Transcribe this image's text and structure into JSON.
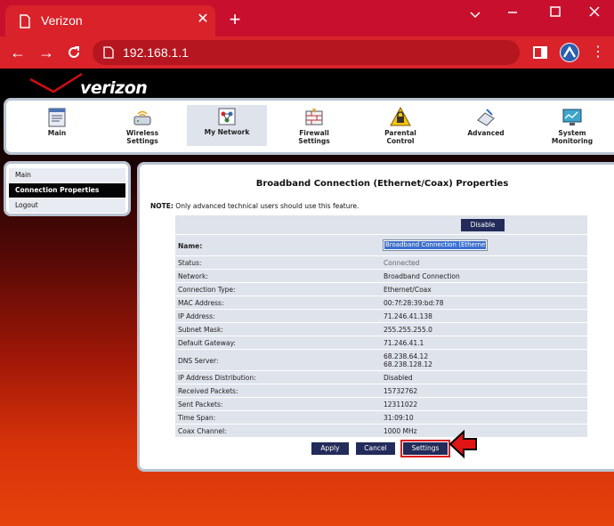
{
  "browser": {
    "tab_title": "Verizon",
    "address": "192.168.1.1",
    "icons": [
      "new-tab-icon",
      "minimize-icon",
      "maximize-icon",
      "close-window-icon",
      "back-icon",
      "forward-icon",
      "reload-icon",
      "info-icon",
      "sidebar-icon",
      "profile-icon",
      "more-icon"
    ]
  },
  "brand": {
    "logo_text": "verizon",
    "accent": "#c8102e"
  },
  "nav": {
    "items": [
      {
        "line1": "Main",
        "line2": ""
      },
      {
        "line1": "Wireless",
        "line2": "Settings"
      },
      {
        "line1": "My Network",
        "line2": ""
      },
      {
        "line1": "Firewall",
        "line2": "Settings"
      },
      {
        "line1": "Parental",
        "line2": "Control"
      },
      {
        "line1": "Advanced",
        "line2": ""
      },
      {
        "line1": "System",
        "line2": "Monitoring"
      }
    ],
    "active": "My Network"
  },
  "sidebar": {
    "items": [
      {
        "label": "Main"
      },
      {
        "label": "Connection Properties"
      },
      {
        "label": "Logout"
      }
    ]
  },
  "panel": {
    "title": "Broadband Connection (Ethernet/Coax) Properties",
    "note_label": "NOTE:",
    "note_text": " Only advanced technical users should use this feature.",
    "disable_label": "Disable",
    "name_label": "Name:",
    "name_value": "Broadband Connection (Ethernet/Co",
    "rows": [
      {
        "key": "Status:",
        "value": "Connected"
      },
      {
        "key": "Network:",
        "value": "Broadband Connection"
      },
      {
        "key": "Connection Type:",
        "value": "Ethernet/Coax"
      },
      {
        "key": "MAC Address:",
        "value": "00:7f:28:39:bd:78"
      },
      {
        "key": "IP Address:",
        "value": "71.246.41.138"
      },
      {
        "key": "Subnet Mask:",
        "value": "255.255.255.0"
      },
      {
        "key": "Default Gateway:",
        "value": "71.246.41.1"
      }
    ],
    "dns": {
      "key": "DNS Server:",
      "value1": "68.238.64.12",
      "value2": "68.238.128.12"
    },
    "rows2": [
      {
        "key": "IP Address Distribution:",
        "value": "Disabled"
      },
      {
        "key": "Received Packets:",
        "value": "15732762"
      },
      {
        "key": "Sent Packets:",
        "value": "12311022"
      },
      {
        "key": "Time Span:",
        "value": "31:09:10"
      },
      {
        "key": "Coax Channel:",
        "value": "1000 MHz"
      }
    ],
    "buttons": {
      "apply": "Apply",
      "cancel": "Cancel",
      "settings": "Settings"
    }
  }
}
